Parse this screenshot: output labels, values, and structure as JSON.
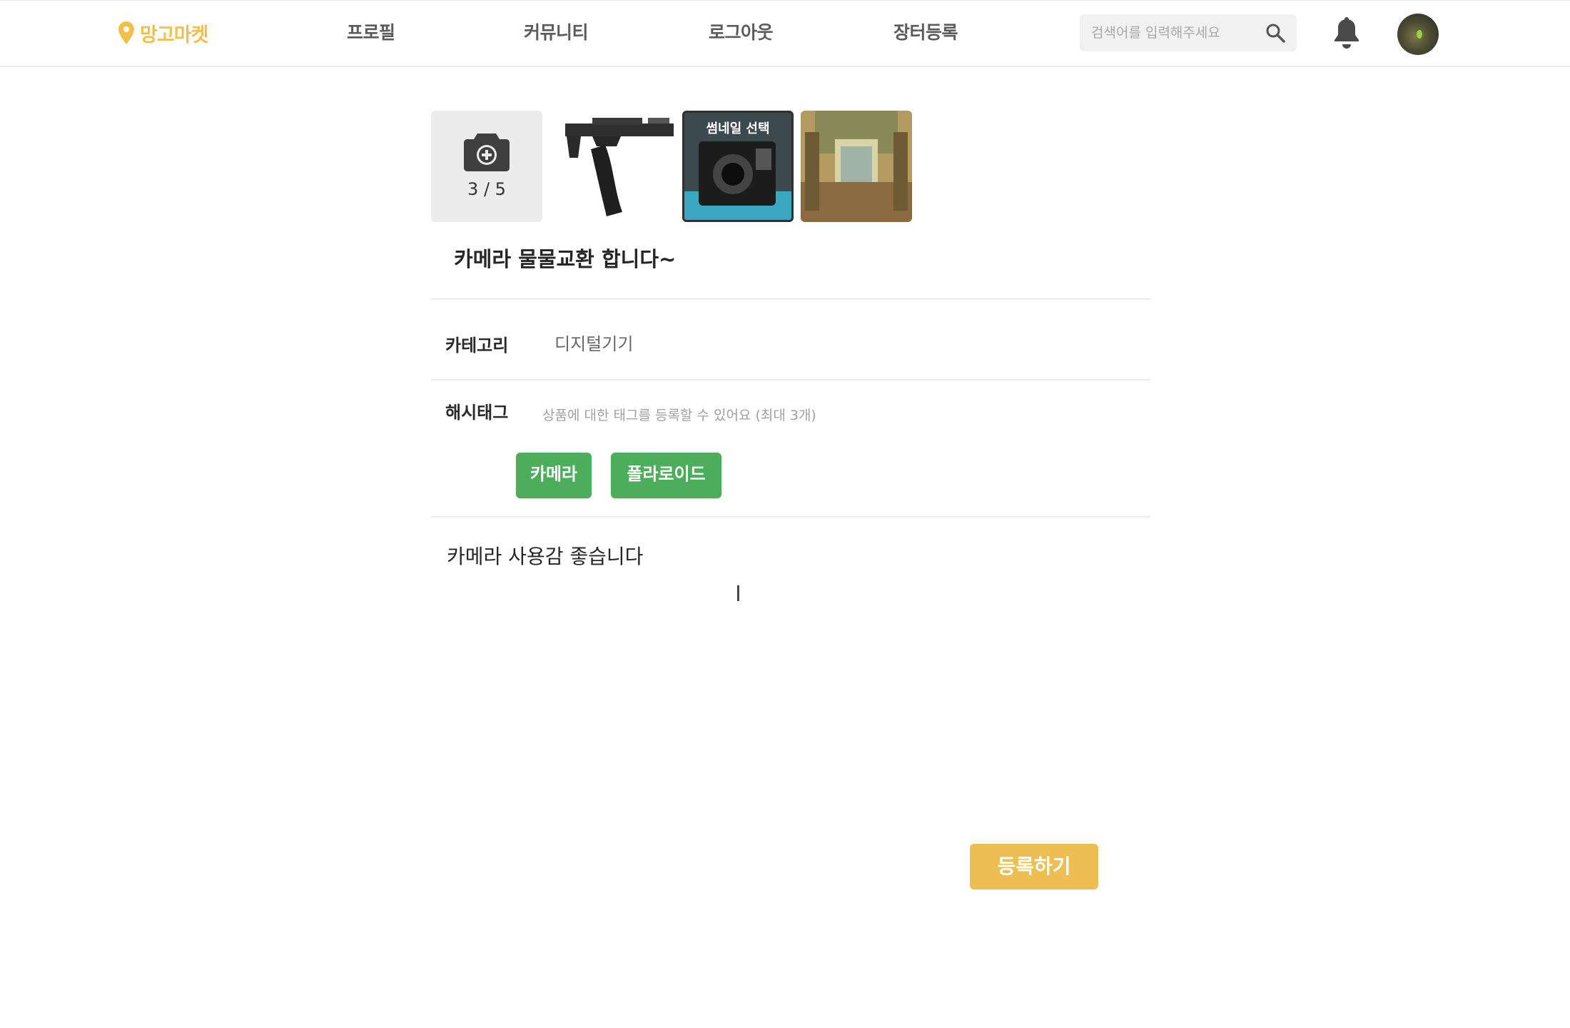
{
  "header": {
    "logo_text": "망고마켓",
    "nav": [
      "프로필",
      "커뮤니티",
      "로그아웃",
      "장터등록"
    ],
    "search_placeholder": "검색어를 입력해주세요"
  },
  "colors": {
    "brand": "#f2c04a",
    "tag_green": "#4cae5b",
    "submit": "#edbf52"
  },
  "upload": {
    "count": "3 / 5",
    "thumbnail_label": "썸네일 선택"
  },
  "form": {
    "title": "카메라 물물교환 합니다~",
    "category_label": "카테고리",
    "category_value": "디지털기기",
    "hashtag_label": "해시태그",
    "hashtag_placeholder": "상품에 대한 태그를 등록할 수 있어요 (최대 3개)",
    "tags": [
      "카메라",
      "폴라로이드"
    ],
    "content": "카메라 사용감 좋습니다",
    "submit_label": "등록하기"
  }
}
